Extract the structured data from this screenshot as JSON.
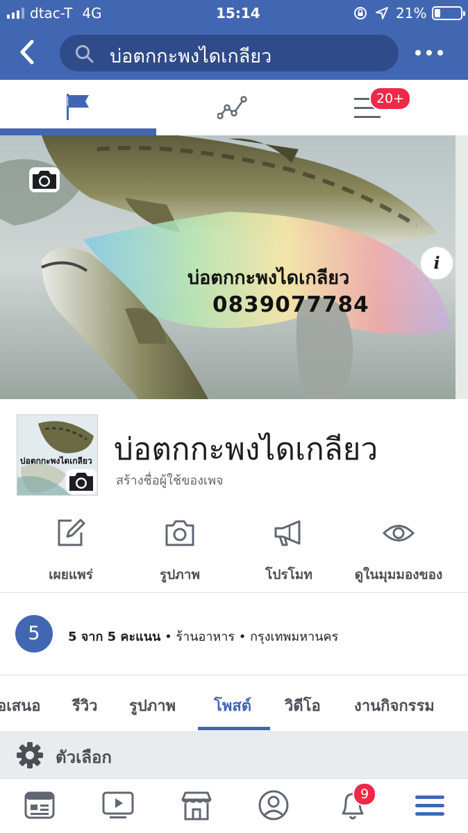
{
  "status_bar": {
    "carrier": "dtac-T",
    "network": "4G",
    "time": "15:14",
    "battery_percent": "21%",
    "battery_level": 0.21
  },
  "nav": {
    "search_text": "บ่อตกกะพงไดเกลียว"
  },
  "page_tabs": {
    "notifications_badge": "20+",
    "active_tab": 0
  },
  "cover": {
    "title": "บ่อตกกะพงไดเกลียว",
    "phone": "0839077784"
  },
  "profile": {
    "name": "บ่อตกกะพงไดเกลียว",
    "username_prompt": "สร้างชื่อผู้ใช้ของเพจ",
    "thumbnail_text": "บ่อตกกะพงไดเกลียว"
  },
  "actions": [
    {
      "label": "เผยแพร่",
      "icon": "edit-icon"
    },
    {
      "label": "รูปภาพ",
      "icon": "camera-icon"
    },
    {
      "label": "โปรโมท",
      "icon": "megaphone-icon"
    },
    {
      "label": "ดูในมุมมองของ",
      "icon": "eye-icon"
    }
  ],
  "info": {
    "rating_value": "5",
    "rating_text": "5 จาก 5 คะแนน",
    "separator": "•",
    "category": "ร้านอาหาร",
    "location": "กรุงเทพมหานคร"
  },
  "section_tabs": [
    "อเสนอ",
    "รีวิว",
    "รูปภาพ",
    "โพสต์",
    "วิดีโอ",
    "งานกิจกรรม"
  ],
  "active_section_tab": 3,
  "options_label": "ตัวเลือก",
  "bottom_nav": {
    "notifications_badge": "9",
    "icons": [
      "news-feed-icon",
      "watch-icon",
      "marketplace-icon",
      "profile-icon",
      "notifications-icon",
      "menu-icon"
    ]
  },
  "colors": {
    "brand": "#4267b2",
    "badge": "#f02849"
  }
}
